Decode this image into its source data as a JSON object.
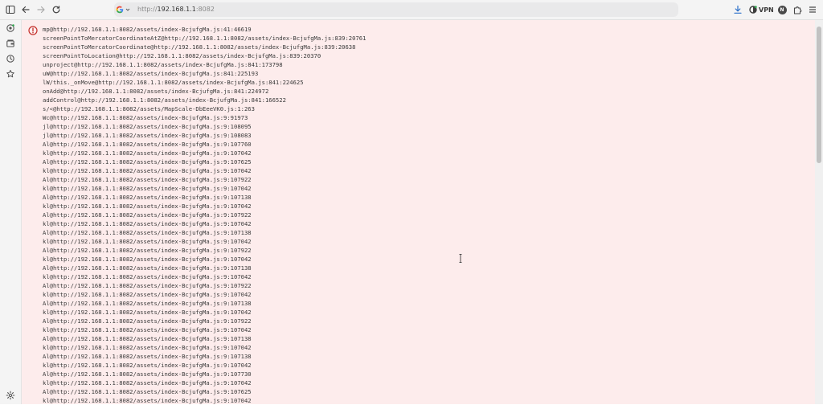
{
  "toolbar": {
    "icons": [
      "sidebar-toggle-icon",
      "back-icon",
      "forward-icon",
      "reload-icon",
      "download-icon",
      "vpn-icon",
      "profile-icon",
      "extensions-icon",
      "menu-icon"
    ],
    "url": {
      "scheme": "http://",
      "host": "192.168.1.1",
      "port": ":8082"
    },
    "vpn_label": "VPN",
    "profile_letter": "N"
  },
  "sidebar": {
    "icons": [
      "messenger-icon",
      "wallet-icon",
      "history-icon",
      "bookmarks-icon",
      "settings-icon"
    ]
  },
  "error": {
    "trace": [
      "mp@http://192.168.1.1:8082/assets/index-BcjufgMa.js:41:46619",
      "screenPointToMercatorCoordinateAtZ@http://192.168.1.1:8082/assets/index-BcjufgMa.js:839:20761",
      "screenPointToMercatorCoordinate@http://192.168.1.1:8082/assets/index-BcjufgMa.js:839:20638",
      "screenPointToLocation@http://192.168.1.1:8082/assets/index-BcjufgMa.js:839:20370",
      "unproject@http://192.168.1.1:8082/assets/index-BcjufgMa.js:841:173798",
      "uW@http://192.168.1.1:8082/assets/index-BcjufgMa.js:841:225193",
      "lW/this._onMove@http://192.168.1.1:8082/assets/index-BcjufgMa.js:841:224625",
      "onAdd@http://192.168.1.1:8082/assets/index-BcjufgMa.js:841:224972",
      "addControl@http://192.168.1.1:8082/assets/index-BcjufgMa.js:841:166522",
      "s/<@http://192.168.1.1:8082/assets/MapScale-DbEeeVK0.js:1:263",
      "Wc@http://192.168.1.1:8082/assets/index-BcjufgMa.js:9:91973",
      "jl@http://192.168.1.1:8082/assets/index-BcjufgMa.js:9:108095",
      "jl@http://192.168.1.1:8082/assets/index-BcjufgMa.js:9:108083",
      "Al@http://192.168.1.1:8082/assets/index-BcjufgMa.js:9:107760",
      "kl@http://192.168.1.1:8082/assets/index-BcjufgMa.js:9:107042",
      "Al@http://192.168.1.1:8082/assets/index-BcjufgMa.js:9:107625",
      "kl@http://192.168.1.1:8082/assets/index-BcjufgMa.js:9:107042",
      "Al@http://192.168.1.1:8082/assets/index-BcjufgMa.js:9:107922",
      "kl@http://192.168.1.1:8082/assets/index-BcjufgMa.js:9:107042",
      "Al@http://192.168.1.1:8082/assets/index-BcjufgMa.js:9:107138",
      "kl@http://192.168.1.1:8082/assets/index-BcjufgMa.js:9:107042",
      "Al@http://192.168.1.1:8082/assets/index-BcjufgMa.js:9:107922",
      "kl@http://192.168.1.1:8082/assets/index-BcjufgMa.js:9:107042",
      "Al@http://192.168.1.1:8082/assets/index-BcjufgMa.js:9:107138",
      "kl@http://192.168.1.1:8082/assets/index-BcjufgMa.js:9:107042",
      "Al@http://192.168.1.1:8082/assets/index-BcjufgMa.js:9:107922",
      "kl@http://192.168.1.1:8082/assets/index-BcjufgMa.js:9:107042",
      "Al@http://192.168.1.1:8082/assets/index-BcjufgMa.js:9:107138",
      "kl@http://192.168.1.1:8082/assets/index-BcjufgMa.js:9:107042",
      "Al@http://192.168.1.1:8082/assets/index-BcjufgMa.js:9:107922",
      "kl@http://192.168.1.1:8082/assets/index-BcjufgMa.js:9:107042",
      "Al@http://192.168.1.1:8082/assets/index-BcjufgMa.js:9:107138",
      "kl@http://192.168.1.1:8082/assets/index-BcjufgMa.js:9:107042",
      "Al@http://192.168.1.1:8082/assets/index-BcjufgMa.js:9:107922",
      "kl@http://192.168.1.1:8082/assets/index-BcjufgMa.js:9:107042",
      "Al@http://192.168.1.1:8082/assets/index-BcjufgMa.js:9:107138",
      "kl@http://192.168.1.1:8082/assets/index-BcjufgMa.js:9:107042",
      "Al@http://192.168.1.1:8082/assets/index-BcjufgMa.js:9:107138",
      "kl@http://192.168.1.1:8082/assets/index-BcjufgMa.js:9:107042",
      "Al@http://192.168.1.1:8082/assets/index-BcjufgMa.js:9:107730",
      "kl@http://192.168.1.1:8082/assets/index-BcjufgMa.js:9:107042",
      "Al@http://192.168.1.1:8082/assets/index-BcjufgMa.js:9:107625",
      "kl@http://192.168.1.1:8082/assets/index-BcjufgMa.js:9:107042"
    ]
  },
  "colors": {
    "error_bg": "#fdecec",
    "error_icon": "#c4302b",
    "text": "#3a3a3a",
    "vpn_dot": "#2fa84f"
  }
}
